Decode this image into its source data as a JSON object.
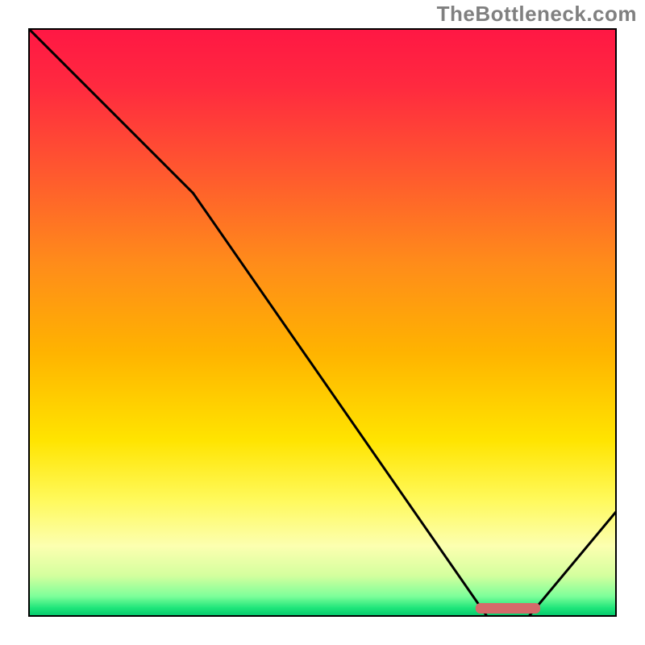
{
  "attribution": "TheBottleneck.com",
  "chart_data": {
    "type": "line",
    "title": "",
    "xlabel": "",
    "ylabel": "",
    "xlim": [
      0,
      100
    ],
    "ylim": [
      0,
      100
    ],
    "curve": {
      "x": [
        0,
        28,
        78,
        85,
        100
      ],
      "y": [
        100,
        72,
        0,
        0,
        18
      ]
    },
    "marker": {
      "x_start": 76,
      "x_end": 87,
      "y": 1.5,
      "color": "#d46a6a"
    },
    "gradient_stops": [
      {
        "offset": 0.0,
        "color": "#ff1744"
      },
      {
        "offset": 0.1,
        "color": "#ff2a3f"
      },
      {
        "offset": 0.25,
        "color": "#ff5a2e"
      },
      {
        "offset": 0.4,
        "color": "#ff8c1a"
      },
      {
        "offset": 0.55,
        "color": "#ffb300"
      },
      {
        "offset": 0.7,
        "color": "#ffe400"
      },
      {
        "offset": 0.8,
        "color": "#fff95a"
      },
      {
        "offset": 0.88,
        "color": "#fcffb0"
      },
      {
        "offset": 0.93,
        "color": "#d4ff9e"
      },
      {
        "offset": 0.965,
        "color": "#7eff9a"
      },
      {
        "offset": 0.985,
        "color": "#1fe57a"
      },
      {
        "offset": 1.0,
        "color": "#00c46a"
      }
    ]
  }
}
